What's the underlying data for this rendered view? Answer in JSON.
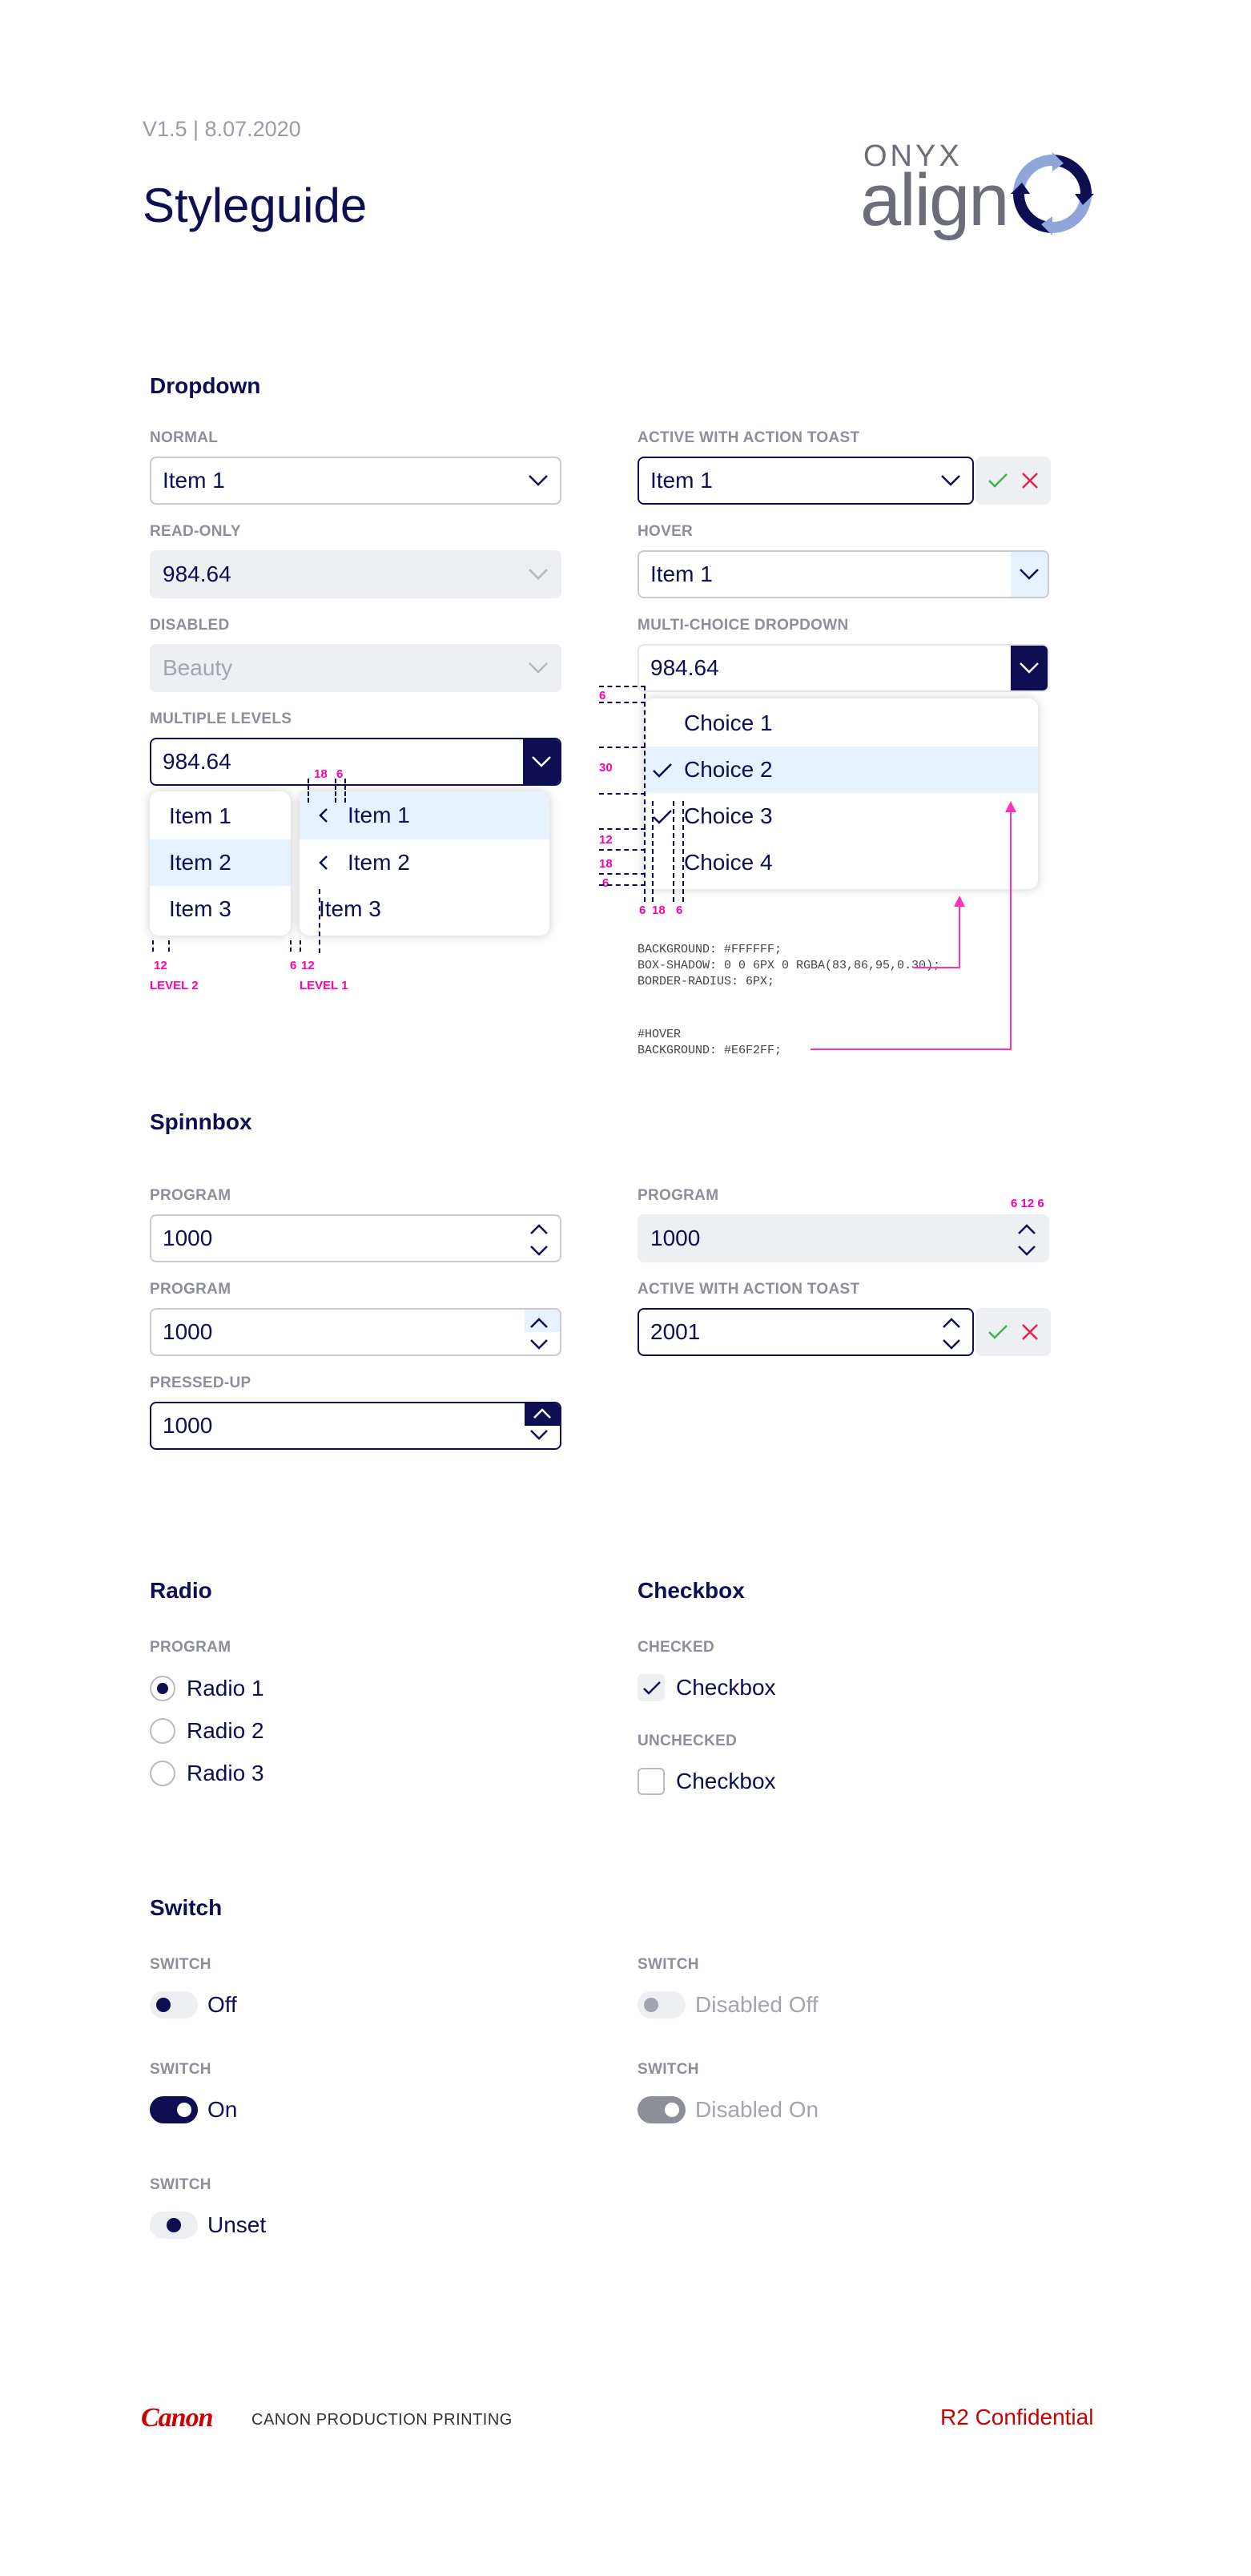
{
  "header": {
    "version": "V1.5 | 8.07.2020",
    "title": "Styleguide",
    "logo_small": "ONYX",
    "logo_large": "align"
  },
  "dropdown": {
    "section": "Dropdown",
    "normal": {
      "label": "NORMAL",
      "value": "Item 1"
    },
    "read_only": {
      "label": "READ-ONLY",
      "value": "984.64"
    },
    "disabled": {
      "label": "DISABLED",
      "value": "Beauty"
    },
    "multiple_levels": {
      "label": "MULTIPLE LEVELS",
      "value": "984.64",
      "level2_items": [
        "Item 1",
        "Item 2",
        "Item 3"
      ],
      "level1_items": [
        "Item 1",
        "Item 2",
        "Item 3"
      ],
      "level2_tag": "LEVEL 2",
      "level1_tag": "LEVEL 1"
    },
    "active_toast": {
      "label": "ACTIVE WITH ACTION TOAST",
      "value": "Item 1"
    },
    "hover": {
      "label": "HOVER",
      "value": "Item 1"
    },
    "multi_choice": {
      "label": "MULTI-CHOICE DROPDOWN",
      "value": "984.64",
      "choices": [
        "Choice 1",
        "Choice 2",
        "Choice 3",
        "Choice 4"
      ],
      "checked": [
        false,
        true,
        true,
        false
      ]
    },
    "note_menu": [
      "BACKGROUND: #FFFFFF;",
      "BOX-SHADOW: 0 0 6PX 0 RGBA(83,86,95,0.30);",
      "BORDER-RADIUS: 6PX;"
    ],
    "note_hover": [
      "#HOVER",
      "BACKGROUND: #E6F2FF;"
    ],
    "measure": {
      "m6": "6",
      "m12": "12",
      "m18": "18",
      "m30": "30"
    }
  },
  "spinbox": {
    "section": "Spinnbox",
    "program1": {
      "label": "PROGRAM",
      "value": "1000"
    },
    "program2": {
      "label": "PROGRAM",
      "value": "1000"
    },
    "pressed_up": {
      "label": "PRESSED-UP",
      "value": "1000"
    },
    "program_ro": {
      "label": "PROGRAM",
      "value": "1000"
    },
    "active_toast": {
      "label": "ACTIVE WITH ACTION TOAST",
      "value": "2001"
    },
    "measure": "6 12 6"
  },
  "radio": {
    "section": "Radio",
    "label": "PROGRAM",
    "options": [
      "Radio 1",
      "Radio 2",
      "Radio 3"
    ],
    "selected": 0
  },
  "checkbox": {
    "section": "Checkbox",
    "checked": {
      "label": "CHECKED",
      "text": "Checkbox"
    },
    "unchecked": {
      "label": "UNCHECKED",
      "text": "Checkbox"
    }
  },
  "switch": {
    "section": "Switch",
    "off": {
      "label": "SWITCH",
      "text": "Off"
    },
    "on": {
      "label": "SWITCH",
      "text": "On"
    },
    "unset": {
      "label": "SWITCH",
      "text": "Unset"
    },
    "disabled_off": {
      "label": "SWITCH",
      "text": "Disabled Off"
    },
    "disabled_on": {
      "label": "SWITCH",
      "text": "Disabled On"
    }
  },
  "footer": {
    "brand": "Canon",
    "company": "CANON PRODUCTION PRINTING",
    "confidential": "R2 Confidential"
  },
  "colors": {
    "navy": "#0e0e52",
    "hover": "#e6f2ff",
    "magenta": "#ff00aa",
    "green": "#3cb54a",
    "red": "#e0244a"
  }
}
